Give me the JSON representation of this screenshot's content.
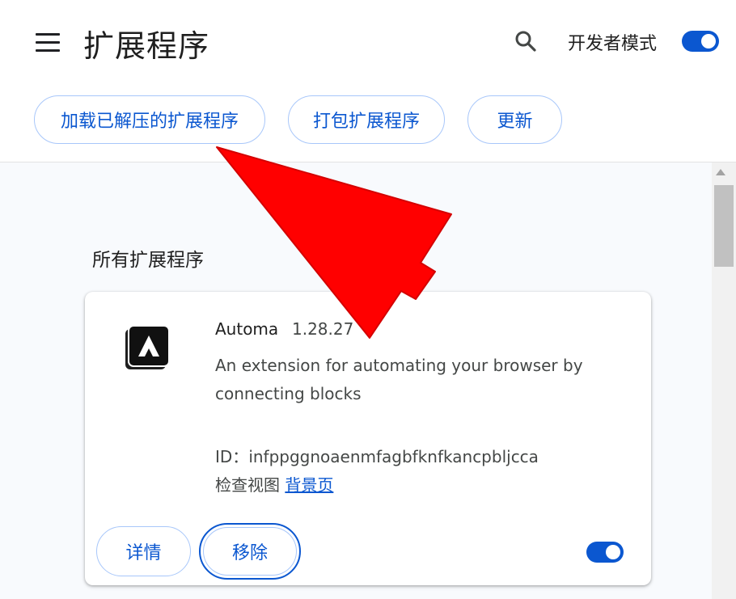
{
  "header": {
    "title": "扩展程序",
    "dev_mode_label": "开发者模式",
    "dev_mode_on": true
  },
  "toolbar": {
    "load_unpacked_label": "加载已解压的扩展程序",
    "pack_label": "打包扩展程序",
    "update_label": "更新"
  },
  "main": {
    "section_title": "所有扩展程序",
    "extension": {
      "name": "Automa",
      "version": "1.28.27",
      "description": "An extension for automating your browser by connecting blocks",
      "id_label": "ID：",
      "id_value": "infppggnoaenmfagbfknfkancpbljcca",
      "inspect_label": "检查视图",
      "inspect_link": "背景页",
      "details_label": "详情",
      "remove_label": "移除",
      "enabled": true
    }
  },
  "icons": {
    "menu": "hamburger-menu-icon",
    "search": "search-icon",
    "extension": "automa-logo-icon"
  },
  "colors": {
    "accent": "#0b57d0",
    "button_border": "#a8c7fa",
    "annotation_arrow": "#ff0000"
  }
}
